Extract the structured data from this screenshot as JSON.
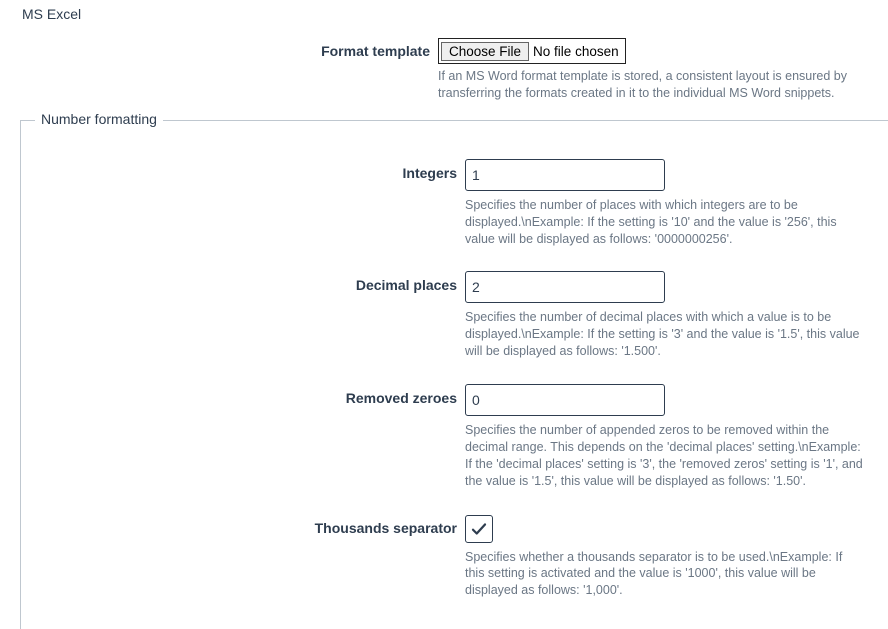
{
  "sectionTitle": "MS Excel",
  "formatTemplate": {
    "label": "Format template",
    "chooseFileLabel": "Choose File",
    "fileStatus": "No file chosen",
    "help": "If an MS Word format template is stored, a consistent layout is ensured by transferring the formats created in it to the individual MS Word snippets."
  },
  "numberFormatting": {
    "title": "Number formatting",
    "integers": {
      "label": "Integers",
      "value": "1",
      "help": "Specifies the number of places with which integers are to be displayed.\\nExample: If the setting is '10' and the value is '256', this value will be displayed as follows: '0000000256'."
    },
    "decimalPlaces": {
      "label": "Decimal places",
      "value": "2",
      "help": "Specifies the number of decimal places with which a value is to be displayed.\\nExample: If the setting is '3' and the value is '1.5', this value will be displayed as follows: '1.500'."
    },
    "removedZeroes": {
      "label": "Removed zeroes",
      "value": "0",
      "help": "Specifies the number of appended zeros to be removed within the decimal range. This depends on the 'decimal places' setting.\\nExample: If the 'decimal places' setting is '3', the 'removed zeros' setting is '1', and the value is '1.5', this value will be displayed as follows: '1.50'."
    },
    "thousandsSeparator": {
      "label": "Thousands separator",
      "checked": true,
      "help": "Specifies whether a thousands separator is to be used.\\nExample: If this setting is activated and the value is '1000', this value will be displayed as follows: '1,000'."
    }
  }
}
